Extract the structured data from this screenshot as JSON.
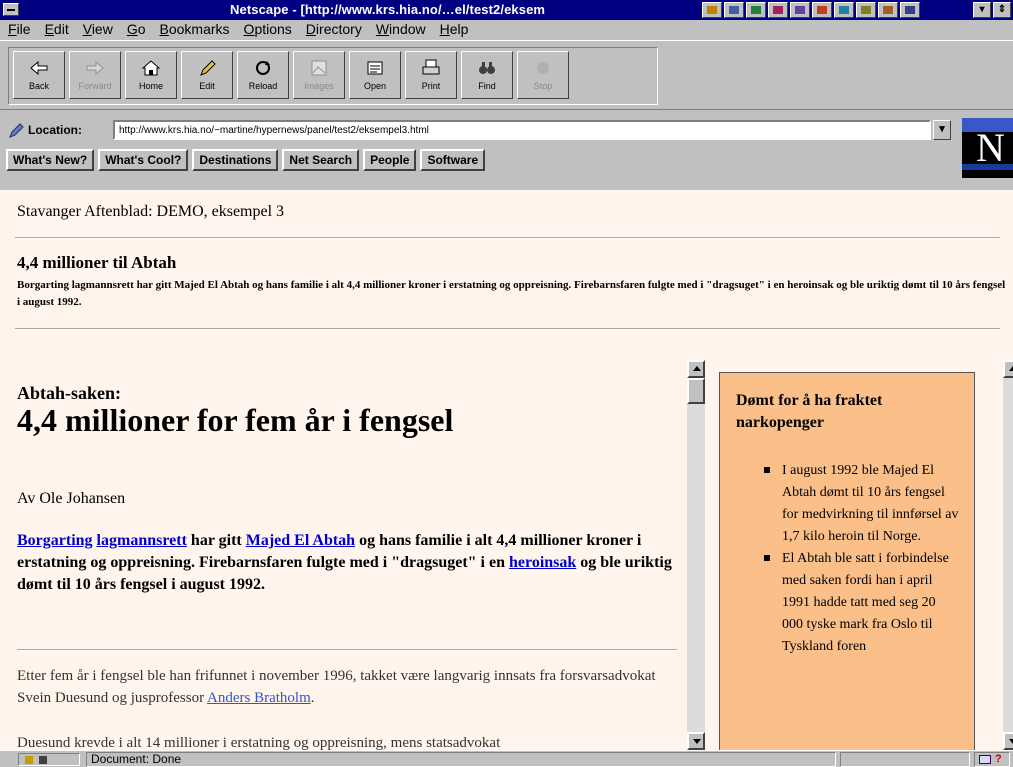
{
  "window": {
    "title": "Netscape - [http://www.krs.hia.no/…el/test2/eksem"
  },
  "menu": [
    "File",
    "Edit",
    "View",
    "Go",
    "Bookmarks",
    "Options",
    "Directory",
    "Window",
    "Help"
  ],
  "toolbar": {
    "back": "Back",
    "forward": "Forward",
    "home": "Home",
    "edit": "Edit",
    "reload": "Reload",
    "images": "Images",
    "open": "Open",
    "print": "Print",
    "find": "Find",
    "stop": "Stop"
  },
  "location": {
    "label": "Location:",
    "url": "http://www.krs.hia.no/~martine/hypernews/panel/test2/eksempel3.html"
  },
  "directory_buttons": [
    "What's New?",
    "What's Cool?",
    "Destinations",
    "Net Search",
    "People",
    "Software"
  ],
  "page": {
    "site_title": "Stavanger Aftenblad: DEMO, eksempel 3",
    "headline": "4,4 millioner til Abtah",
    "lead": "Borgarting lagmannsrett har gitt Majed El Abtah og hans familie i alt 4,4 millioner kroner i erstatning og oppreisning. Firebarnsfaren fulgte med i \"dragsuget\" i en heroinsak og ble uriktig dømt til 10 års fengsel i august 1992.",
    "kicker": "Abtah-saken:",
    "article_title": "4,4 millioner for fem år i fengsel",
    "byline": "Av Ole Johansen",
    "ingress": {
      "link1": "Borgarting",
      "link2": "lagmannsrett",
      "text1": " har gitt ",
      "link3": "Majed El Abtah",
      "text2": " og hans familie i alt 4,4 millioner kroner i erstatning og oppreisning. Firebarnsfaren fulgte med i \"dragsuget\" i en ",
      "link4": "heroinsak",
      "text3": " og ble uriktig dømt til 10 års fengsel i august 1992."
    },
    "para1_text": "Etter fem år i fengsel ble han frifunnet i november 1996, takket være langvarig innsats fra forsvarsadvokat Svein Duesund og jusprofessor ",
    "para1_link": "Anders Bratholm",
    "para1_end": ".",
    "para2": "Duesund krevde i alt 14 millioner i erstatning og oppreisning, mens statsadvokat"
  },
  "sidebar": {
    "title": "Dømt for å ha fraktet narkopenger",
    "items": [
      "I august 1992 ble Majed El Abtah dømt til 10 års fengsel for medvirkning til innførsel av 1,7 kilo heroin til Norge.",
      "El Abtah ble satt i forbindelse med saken fordi han i april 1991 hadde tatt med seg 20 000 tyske mark fra Oslo til Tyskland foren"
    ]
  },
  "status": {
    "text": "Document: Done"
  }
}
